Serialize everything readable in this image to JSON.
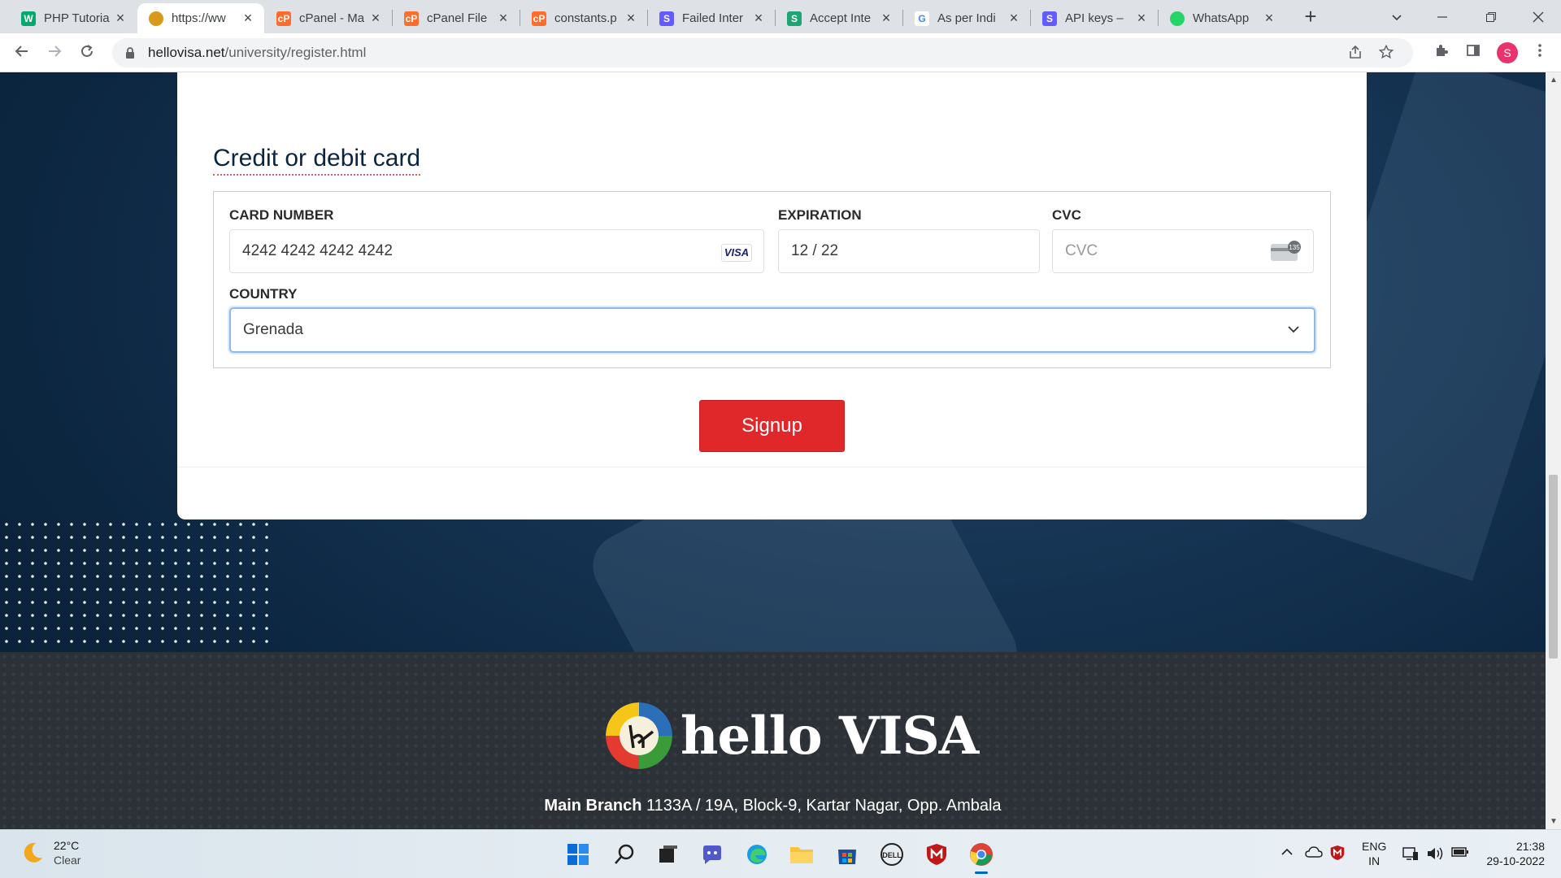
{
  "browser": {
    "tabs": [
      {
        "title": "PHP Tutoria",
        "favicon": "w3schools-icon",
        "color": "#04aa6d",
        "glyph": "W"
      },
      {
        "title": "https://ww",
        "favicon": "hellovisa-icon",
        "color": "#d89a1a",
        "glyph": "",
        "active": true
      },
      {
        "title": "cPanel - Ma",
        "favicon": "cpanel-icon",
        "color": "#ff6c2c",
        "glyph": "cP"
      },
      {
        "title": "cPanel File",
        "favicon": "cpanel-icon",
        "color": "#ff6c2c",
        "glyph": "cP"
      },
      {
        "title": "constants.p",
        "favicon": "cpanel-icon",
        "color": "#ff6c2c",
        "glyph": "cP"
      },
      {
        "title": "Failed Inter",
        "favicon": "stripe-icon",
        "color": "#635bff",
        "glyph": "S"
      },
      {
        "title": "Accept Inte",
        "favicon": "stripe-icon",
        "color": "#1ea672",
        "glyph": "S"
      },
      {
        "title": "As per Indi",
        "favicon": "google-icon",
        "color": "#4285f4",
        "glyph": "G"
      },
      {
        "title": "API keys –",
        "favicon": "stripe-icon",
        "color": "#635bff",
        "glyph": "S"
      },
      {
        "title": "WhatsApp",
        "favicon": "whatsapp-icon",
        "color": "#25d366",
        "glyph": ""
      }
    ],
    "url_host": "hellovisa.net",
    "url_path": "/university/register.html"
  },
  "form": {
    "section_title": "Credit or debit card",
    "card_number_label": "CARD NUMBER",
    "card_number_value": "4242 4242 4242 4242",
    "card_brand": "VISA",
    "expiration_label": "EXPIRATION",
    "expiration_value": "12 / 22",
    "cvc_label": "CVC",
    "cvc_placeholder": "CVC",
    "cvc_icon_text": "135",
    "country_label": "COUNTRY",
    "country_value": "Grenada",
    "signup_label": "Signup"
  },
  "footer": {
    "logo_text": "hello VISA",
    "branch_label": "Main Branch",
    "branch_address": "1133A / 19A, Block-9, Kartar Nagar, Opp. Ambala"
  },
  "taskbar": {
    "temperature": "22°C",
    "condition": "Clear",
    "lang_top": "ENG",
    "lang_bottom": "IN",
    "time": "21:38",
    "date": "29-10-2022"
  },
  "colors": {
    "accent_red": "#e0282a",
    "title_navy": "#0b2540",
    "focus_blue": "#8fb7e8"
  }
}
